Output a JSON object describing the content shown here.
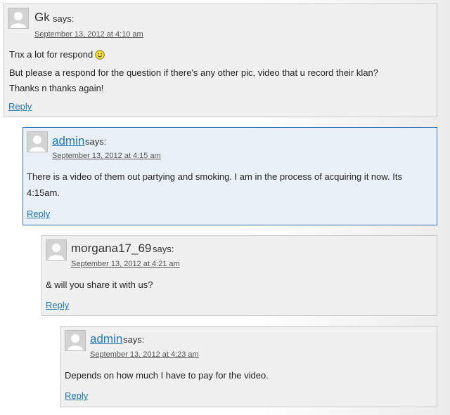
{
  "comments": [
    {
      "author": "Gk",
      "says": "says:",
      "date": "September 13, 2012 at 4:10 am",
      "lines": [
        "Tnx a lot for respond",
        "But please a respond for the question if there's any other pic, video that u record their klan?",
        "Thanks n thanks again!"
      ],
      "smiley_icon": "smiley-icon",
      "reply": "Reply"
    },
    {
      "author": "admin",
      "says": "says:",
      "date": "September 13, 2012 at 4:15 am",
      "lines": [
        "There is a video of them out partying and smoking. I am in the process of acquiring it now. Its",
        "4:15am."
      ],
      "reply": "Reply"
    },
    {
      "author": "morgana17_69",
      "says": "says:",
      "date": "September 13, 2012 at 4:21 am",
      "lines": [
        "& will you share it with us?"
      ],
      "reply": "Reply"
    },
    {
      "author": "admin",
      "says": "says:",
      "date": "September 13, 2012 at 4:23 am",
      "lines": [
        "Depends on how much I have to pay for the video."
      ],
      "reply": "Reply"
    }
  ],
  "colors": {
    "link": "#1f77b4",
    "highlight_bg": "#e9f0f7",
    "highlight_border": "#3a6fa5",
    "comment_bg": "#f0f0f0"
  }
}
